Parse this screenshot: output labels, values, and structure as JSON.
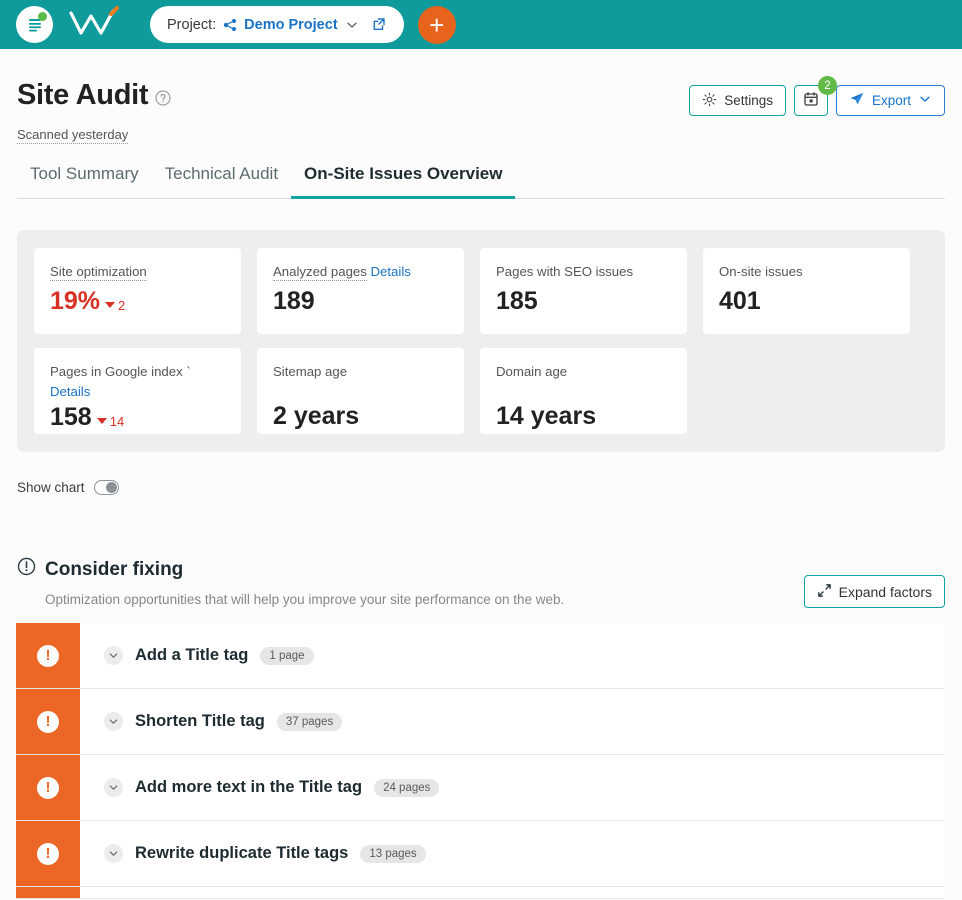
{
  "topbar": {
    "logo_icon": "document-lines-icon",
    "logo_wordmark": "w-logo-icon",
    "project_label": "Project:",
    "project_name": "Demo Project",
    "project_share_icon": "share-nodes-icon",
    "project_chevron_icon": "chevron-down-icon",
    "project_external_icon": "external-link-icon",
    "add_button_label": "+",
    "brand_color": "#0f9b9b",
    "accent_orange": "#e8641c"
  },
  "header": {
    "title": "Site Audit",
    "help_icon": "question-circle-icon",
    "scanned": "Scanned yesterday",
    "settings_label": "Settings",
    "settings_icon": "gear-icon",
    "calendar_icon": "calendar-icon",
    "calendar_badge": "2",
    "export_label": "Export",
    "export_icon": "send-plane-icon",
    "export_chevron_icon": "chevron-down-icon"
  },
  "tabs": [
    {
      "label": "Tool Summary",
      "active": false
    },
    {
      "label": "Technical Audit",
      "active": false
    },
    {
      "label": "On-Site Issues Overview",
      "active": true
    }
  ],
  "stats": {
    "row1": [
      {
        "label": "Site optimization",
        "dotted": true,
        "details": null,
        "value": "19%",
        "value_color": "#d93025",
        "delta": "2",
        "delta_dir": "down"
      },
      {
        "label": "Analyzed pages",
        "dotted": true,
        "details": "Details",
        "value": "189",
        "value_color": "#222222",
        "delta": null,
        "delta_dir": null
      },
      {
        "label": "Pages with SEO issues",
        "dotted": false,
        "details": null,
        "value": "185",
        "value_color": "#222222",
        "delta": null,
        "delta_dir": null
      },
      {
        "label": "On-site issues",
        "dotted": false,
        "details": null,
        "value": "401",
        "value_color": "#222222",
        "delta": null,
        "delta_dir": null
      }
    ],
    "row2": [
      {
        "label": "Pages in Google index `",
        "dotted": false,
        "details": "Details",
        "details_newline": true,
        "value": "158",
        "value_color": "#222222",
        "delta": "14",
        "delta_dir": "down"
      },
      {
        "label": "Sitemap age",
        "dotted": false,
        "details": null,
        "value": "2 years",
        "value_color": "#222222",
        "delta": null,
        "delta_dir": null
      },
      {
        "label": "Domain age",
        "dotted": false,
        "details": null,
        "value": "14 years",
        "value_color": "#222222",
        "delta": null,
        "delta_dir": null
      }
    ]
  },
  "show_chart": {
    "label": "Show chart",
    "state": "off"
  },
  "consider_fixing": {
    "title": "Consider fixing",
    "title_icon": "exclamation-circle-icon",
    "subtitle": "Optimization opportunities that will help you improve your site performance on the web.",
    "expand_label": "Expand factors",
    "expand_icon": "expand-arrows-icon"
  },
  "issues": [
    {
      "severity": "warning",
      "severity_color": "#ec6625",
      "name": "Add a Title tag",
      "count": "1 page"
    },
    {
      "severity": "warning",
      "severity_color": "#ec6625",
      "name": "Shorten Title tag",
      "count": "37 pages"
    },
    {
      "severity": "warning",
      "severity_color": "#ec6625",
      "name": "Add more text in the Title tag",
      "count": "24 pages"
    },
    {
      "severity": "warning",
      "severity_color": "#ec6625",
      "name": "Rewrite duplicate Title tags",
      "count": "13 pages"
    }
  ]
}
